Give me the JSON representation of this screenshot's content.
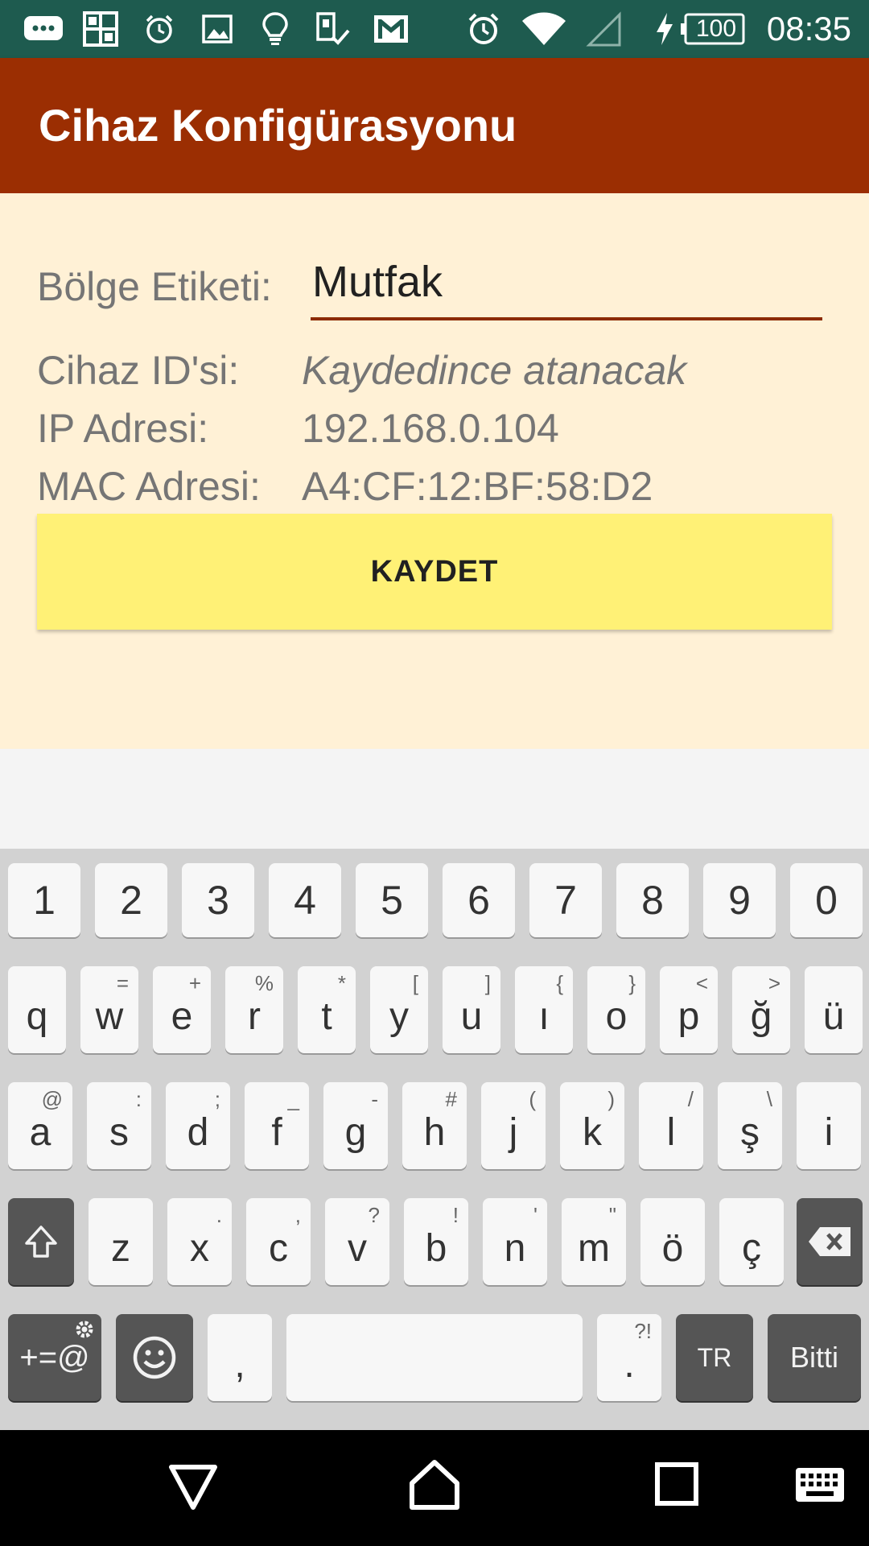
{
  "status_bar": {
    "time": "08:35",
    "battery": "100",
    "icons": [
      "messages-icon",
      "app-grid-icon",
      "alarm-icon",
      "gallery-icon",
      "lightbulb-icon",
      "sim-check-icon",
      "gmail-icon",
      "alarm-clock-icon",
      "wifi-icon",
      "signal-icon",
      "charging-icon",
      "battery-icon"
    ]
  },
  "app_bar": {
    "title": "Cihaz Konfigürasyonu",
    "color": "#9b2e02"
  },
  "form": {
    "zone_label": "Bölge Etiketi:",
    "zone_value": "Mutfak",
    "device_id_label": "Cihaz ID'si:",
    "device_id_value": "Kaydedince atanacak",
    "ip_label": "IP Adresi:",
    "ip_value": "192.168.0.104",
    "mac_label": "MAC Adresi:",
    "mac_value": "A4:CF:12:BF:58:D2",
    "save_button": "KAYDET",
    "save_color": "#fff176",
    "background_color": "#fff1d6"
  },
  "keyboard": {
    "number_row": [
      "1",
      "2",
      "3",
      "4",
      "5",
      "6",
      "7",
      "8",
      "9",
      "0"
    ],
    "row1": [
      {
        "k": "q",
        "h": ""
      },
      {
        "k": "w",
        "h": "="
      },
      {
        "k": "e",
        "h": "+"
      },
      {
        "k": "r",
        "h": "%"
      },
      {
        "k": "t",
        "h": "*"
      },
      {
        "k": "y",
        "h": "["
      },
      {
        "k": "u",
        "h": "]"
      },
      {
        "k": "ı",
        "h": "{"
      },
      {
        "k": "o",
        "h": "}"
      },
      {
        "k": "p",
        "h": "<"
      },
      {
        "k": "ğ",
        "h": ">"
      },
      {
        "k": "ü",
        "h": ""
      }
    ],
    "row2": [
      {
        "k": "a",
        "h": "@"
      },
      {
        "k": "s",
        "h": ":"
      },
      {
        "k": "d",
        "h": ";"
      },
      {
        "k": "f",
        "h": "_"
      },
      {
        "k": "g",
        "h": "-"
      },
      {
        "k": "h",
        "h": "#"
      },
      {
        "k": "j",
        "h": "("
      },
      {
        "k": "k",
        "h": ")"
      },
      {
        "k": "l",
        "h": "/"
      },
      {
        "k": "ş",
        "h": "\\"
      },
      {
        "k": "i",
        "h": ""
      }
    ],
    "row3": [
      {
        "k": "z",
        "h": ""
      },
      {
        "k": "x",
        "h": "."
      },
      {
        "k": "c",
        "h": ","
      },
      {
        "k": "v",
        "h": "?"
      },
      {
        "k": "b",
        "h": "!"
      },
      {
        "k": "n",
        "h": "'"
      },
      {
        "k": "m",
        "h": "\""
      },
      {
        "k": "ö",
        "h": ""
      },
      {
        "k": "ç",
        "h": ""
      }
    ],
    "symbols_key": "+=@",
    "comma_key": ",",
    "period_key": ".",
    "period_hint": "?!",
    "language_key": "TR",
    "done_key": "Bitti"
  },
  "nav_bar": {
    "icons": [
      "back-icon",
      "home-icon",
      "recents-icon",
      "keyboard-switch-icon"
    ]
  }
}
